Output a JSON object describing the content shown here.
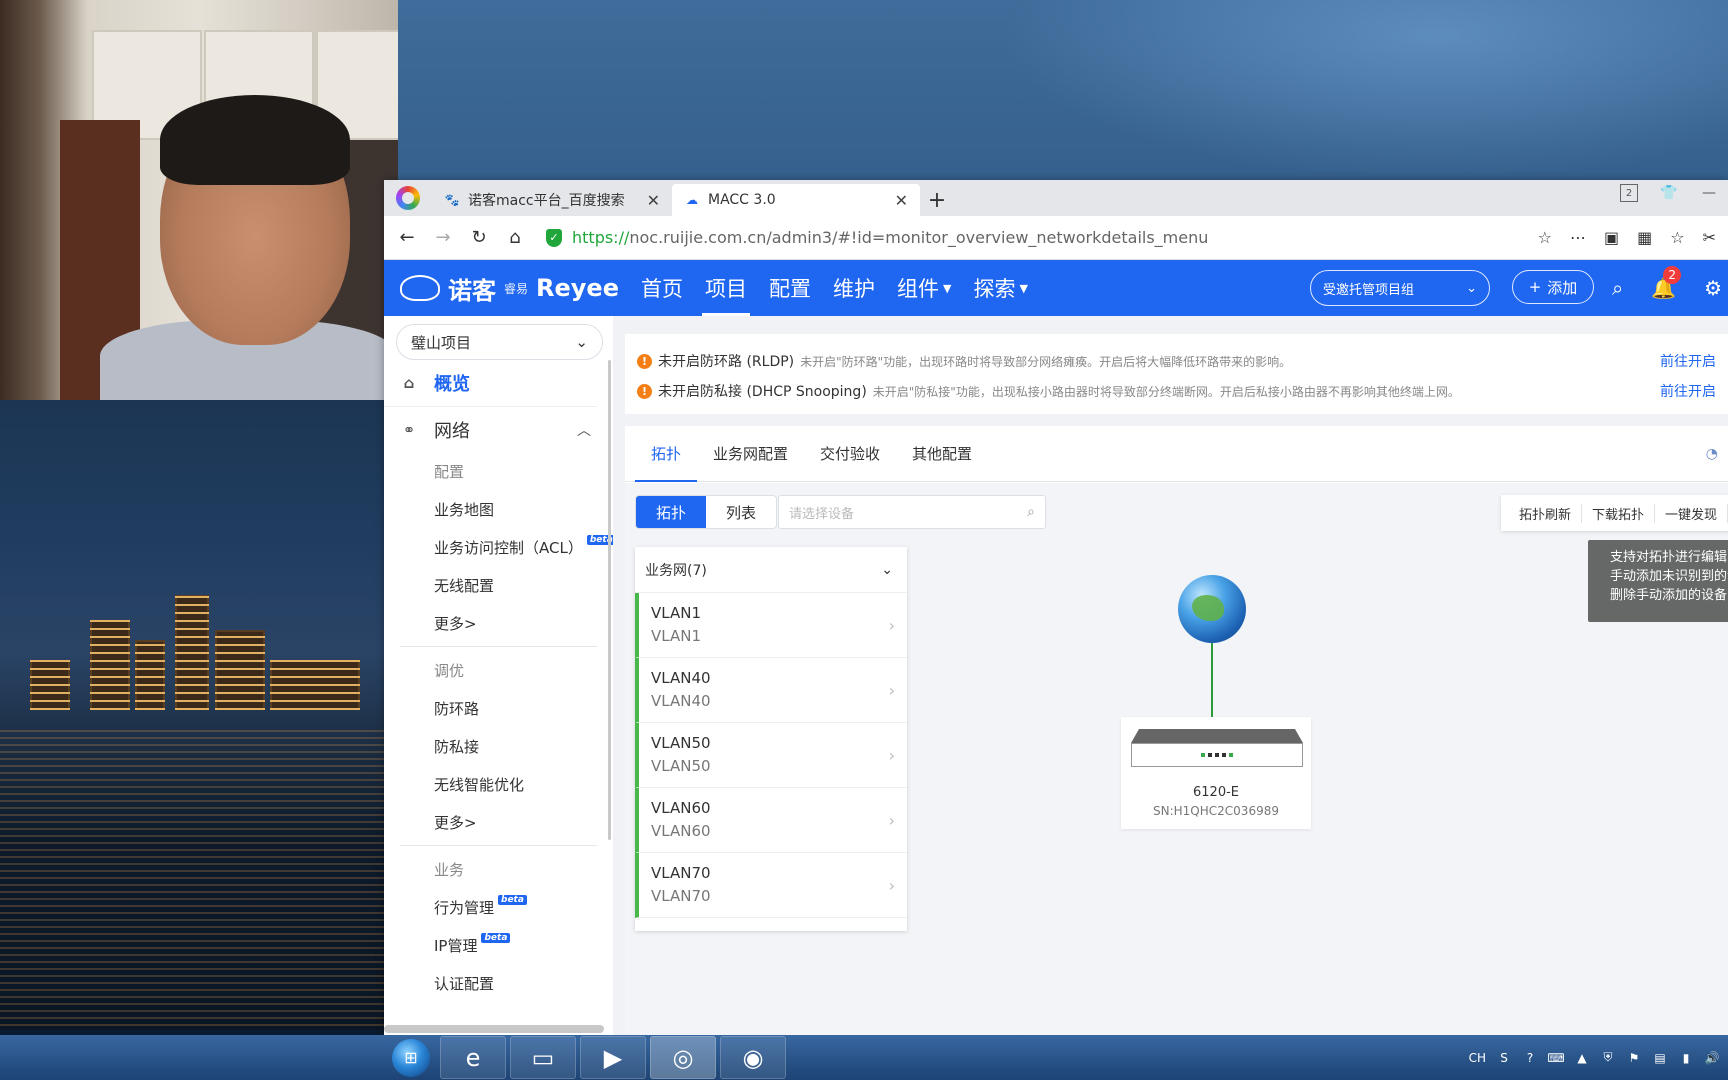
{
  "browser": {
    "tabs": [
      {
        "title": "诺客macc平台_百度搜索",
        "icon": "paw-icon"
      },
      {
        "title": "MACC 3.0",
        "icon": "cloud-icon"
      }
    ],
    "new_tab": "+",
    "window_badge": "2",
    "url_scheme": "https://",
    "url_rest": "noc.ruijie.com.cn/admin3/#!id=monitor_overview_networkdetails_menu"
  },
  "app": {
    "brand": "诺客",
    "brand_sub": "睿易",
    "brand_en": "Reyee",
    "nav": [
      {
        "label": "首页",
        "has_caret": false
      },
      {
        "label": "项目",
        "has_caret": false
      },
      {
        "label": "配置",
        "has_caret": false
      },
      {
        "label": "维护",
        "has_caret": false
      },
      {
        "label": "组件",
        "has_caret": true
      },
      {
        "label": "探索",
        "has_caret": true
      }
    ],
    "active_nav": "项目",
    "project_group": "受邀托管项目组",
    "add_label": "添加",
    "notification_count": "2"
  },
  "sidebar": {
    "site": "璧山项目",
    "overview": "概览",
    "network": "网络",
    "groups": [
      {
        "title": "配置",
        "items": [
          {
            "label": "业务地图",
            "beta": false
          },
          {
            "label": "业务访问控制（ACL）",
            "beta": true
          },
          {
            "label": "无线配置",
            "beta": false
          },
          {
            "label": "更多>",
            "beta": false
          }
        ]
      },
      {
        "title": "调优",
        "items": [
          {
            "label": "防环路",
            "beta": false
          },
          {
            "label": "防私接",
            "beta": false
          },
          {
            "label": "无线智能优化",
            "beta": false
          },
          {
            "label": "更多>",
            "beta": false
          }
        ]
      },
      {
        "title": "业务",
        "items": [
          {
            "label": "行为管理",
            "beta": true
          },
          {
            "label": "IP管理",
            "beta": true
          },
          {
            "label": "认证配置",
            "beta": false
          }
        ]
      }
    ],
    "beta_label": "beta"
  },
  "alerts": [
    {
      "title": "未开启防环路 (RLDP)",
      "desc": "未开启\"防环路\"功能，出现环路时将导致部分网络瘫痪。开启后将大幅降低环路带来的影响。",
      "link": "前往开启"
    },
    {
      "title": "未开启防私接 (DHCP Snooping)",
      "desc": "未开启\"防私接\"功能，出现私接小路由器时将导致部分终端断网。开启后私接小路由器不再影响其他终端上网。",
      "link": "前往开启"
    }
  ],
  "main_tabs": [
    "拓扑",
    "业务网配置",
    "交付验收",
    "其他配置"
  ],
  "active_main_tab": "拓扑",
  "view_toggle": {
    "topology": "拓扑",
    "list": "列表"
  },
  "device_search_placeholder": "请选择设备",
  "topo_actions": [
    "拓扑刷新",
    "下载拓扑",
    "一键发现"
  ],
  "tooltip_lines": [
    "支持对拓扑进行编辑",
    "手动添加未识别到的设",
    "删除手动添加的设备"
  ],
  "vlan_panel": {
    "header": "业务网(7)",
    "items": [
      {
        "title": "VLAN1",
        "sub": "VLAN1"
      },
      {
        "title": "VLAN40",
        "sub": "VLAN40"
      },
      {
        "title": "VLAN50",
        "sub": "VLAN50"
      },
      {
        "title": "VLAN60",
        "sub": "VLAN60"
      },
      {
        "title": "VLAN70",
        "sub": "VLAN70"
      }
    ]
  },
  "device": {
    "name": "6120-E",
    "sn": "SN:H1QHC2C036989"
  },
  "taskbar": {
    "apps": [
      "ie-icon",
      "folder-icon",
      "media-player-icon",
      "browser-icon",
      "obs-icon"
    ],
    "tray_lang": "CH"
  },
  "colors": {
    "brand_blue": "#1f66f0",
    "vlan_accent": "#49b84a",
    "warn": "#f57f17"
  }
}
